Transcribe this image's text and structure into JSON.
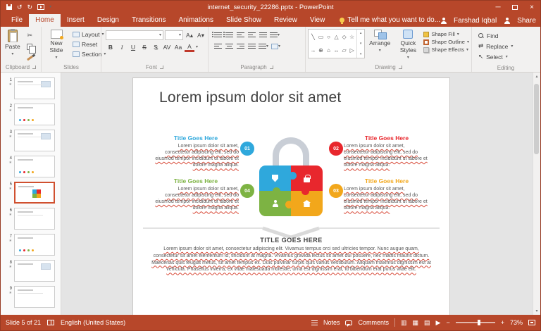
{
  "titlebar": {
    "title": "internet_security_22286.pptx - PowerPoint"
  },
  "tabs": {
    "file": "File",
    "items": [
      "Home",
      "Insert",
      "Design",
      "Transitions",
      "Animations",
      "Slide Show",
      "Review",
      "View"
    ],
    "tell_me": "Tell me what you want to do...",
    "user_name": "Farshad Iqbal",
    "share": "Share"
  },
  "ribbon": {
    "clipboard": {
      "label": "Clipboard",
      "paste": "Paste"
    },
    "slides": {
      "label": "Slides",
      "new_slide": "New Slide",
      "layout": "Layout",
      "reset": "Reset",
      "section": "Section"
    },
    "font": {
      "label": "Font",
      "font_name": "",
      "font_size": ""
    },
    "paragraph": {
      "label": "Paragraph"
    },
    "drawing": {
      "label": "Drawing",
      "arrange": "Arrange",
      "quick_styles": "Quick Styles",
      "shape_fill": "Shape Fill",
      "shape_outline": "Shape Outline",
      "shape_effects": "Shape Effects"
    },
    "editing": {
      "label": "Editing",
      "find": "Find",
      "replace": "Replace",
      "select": "Select"
    }
  },
  "shapes_gallery": [
    "╲",
    "▭",
    "○",
    "△",
    "◇",
    "☆",
    "→",
    "⊕",
    "⌂",
    "↔",
    "▱",
    "▷"
  ],
  "slide_panel": {
    "numbers": [
      "1",
      "2",
      "3",
      "4",
      "5",
      "6",
      "7",
      "8",
      "9"
    ],
    "selected": "5"
  },
  "slide": {
    "title": "Lorem ipsum dolor sit amet",
    "blocks": [
      {
        "num": "01",
        "heading": "Title Goes Here",
        "color": "#2FA8DC",
        "body": "Lorem ipsum dolor sit amet, consectetur adipiscing elit, sed do eiusmod tempor incididunt ut labore et dolore magna aliqua."
      },
      {
        "num": "02",
        "heading": "Title Goes Here",
        "color": "#E8272D",
        "body": "Lorem ipsum dolor sit amet, consectetur adipiscing elit, sed do eiusmod tempor incididunt ut labore et dolore magna aliqua."
      },
      {
        "num": "04",
        "heading": "Title Goes Here",
        "color": "#7DB343",
        "body": "Lorem ipsum dolor sit amet, consectetur adipiscing elit, sed do eiusmod tempor incididunt ut labore et dolore magna aliqua."
      },
      {
        "num": "03",
        "heading": "Title Goes Here",
        "color": "#F2A71B",
        "body": "Lorem ipsum dolor sit amet, consectetur adipiscing elit, sed do eiusmod tempor incididunt ut labore et dolore magna aliqua."
      }
    ],
    "bottom_heading": "TITLE GOES HERE",
    "bottom_body": "Lorem ipsum dolor sit amet, consectetur adipiscing elit. Vivamus tempus orci sed ultricies tempor. Nunc augue quam, consectetur sit amet elementum id, tincidunt at magna. Vivamus gravida lectus sit amet dui posuere, nec mattis mauris dictum. Maecenas quis feugiat metus, sit amet tempus ex. Duis pulvinar turpis quis varius vestibulum. Aliquam maximus dignissim est at vehicula. Phasellus viverra, ex vitae malesuada molestie, urna est dignissim erat, id bibendum erat purus vitae elit."
  },
  "statusbar": {
    "slide_indicator": "Slide 5 of 21",
    "language": "English (United States)",
    "notes": "Notes",
    "comments": "Comments",
    "zoom": "73%"
  },
  "icons": {
    "caret": "▾",
    "cut": "✂",
    "undo": "↺",
    "redo": "↻",
    "star": "★",
    "close": "×",
    "minimize": "─",
    "scroll_up": "▲",
    "scroll_down": "▼",
    "small_up": "▴",
    "small_down": "▾",
    "bold": "B",
    "italic": "I",
    "underline": "U",
    "strike": "S",
    "shadow": "S",
    "spacing": "AV",
    "case": "Aa",
    "font_color": "A",
    "grow_font": "A▴",
    "shrink_font": "A▾",
    "clear_format": "A",
    "replace": "⇄",
    "select": "↖",
    "view_normal": "▥",
    "view_sorter": "▦",
    "view_reading": "▤",
    "view_show": "▶",
    "zoom_out": "−",
    "zoom_in": "+"
  },
  "colors": {
    "titlebar": "#B7472A",
    "ribbon_bg": "#F2F1F0",
    "selection_border": "#D0502F",
    "blue": "#2FA8DC",
    "red": "#E8272D",
    "green": "#7DB343",
    "yellow": "#F2A71B",
    "shackle_gray": "#C9CED6"
  }
}
